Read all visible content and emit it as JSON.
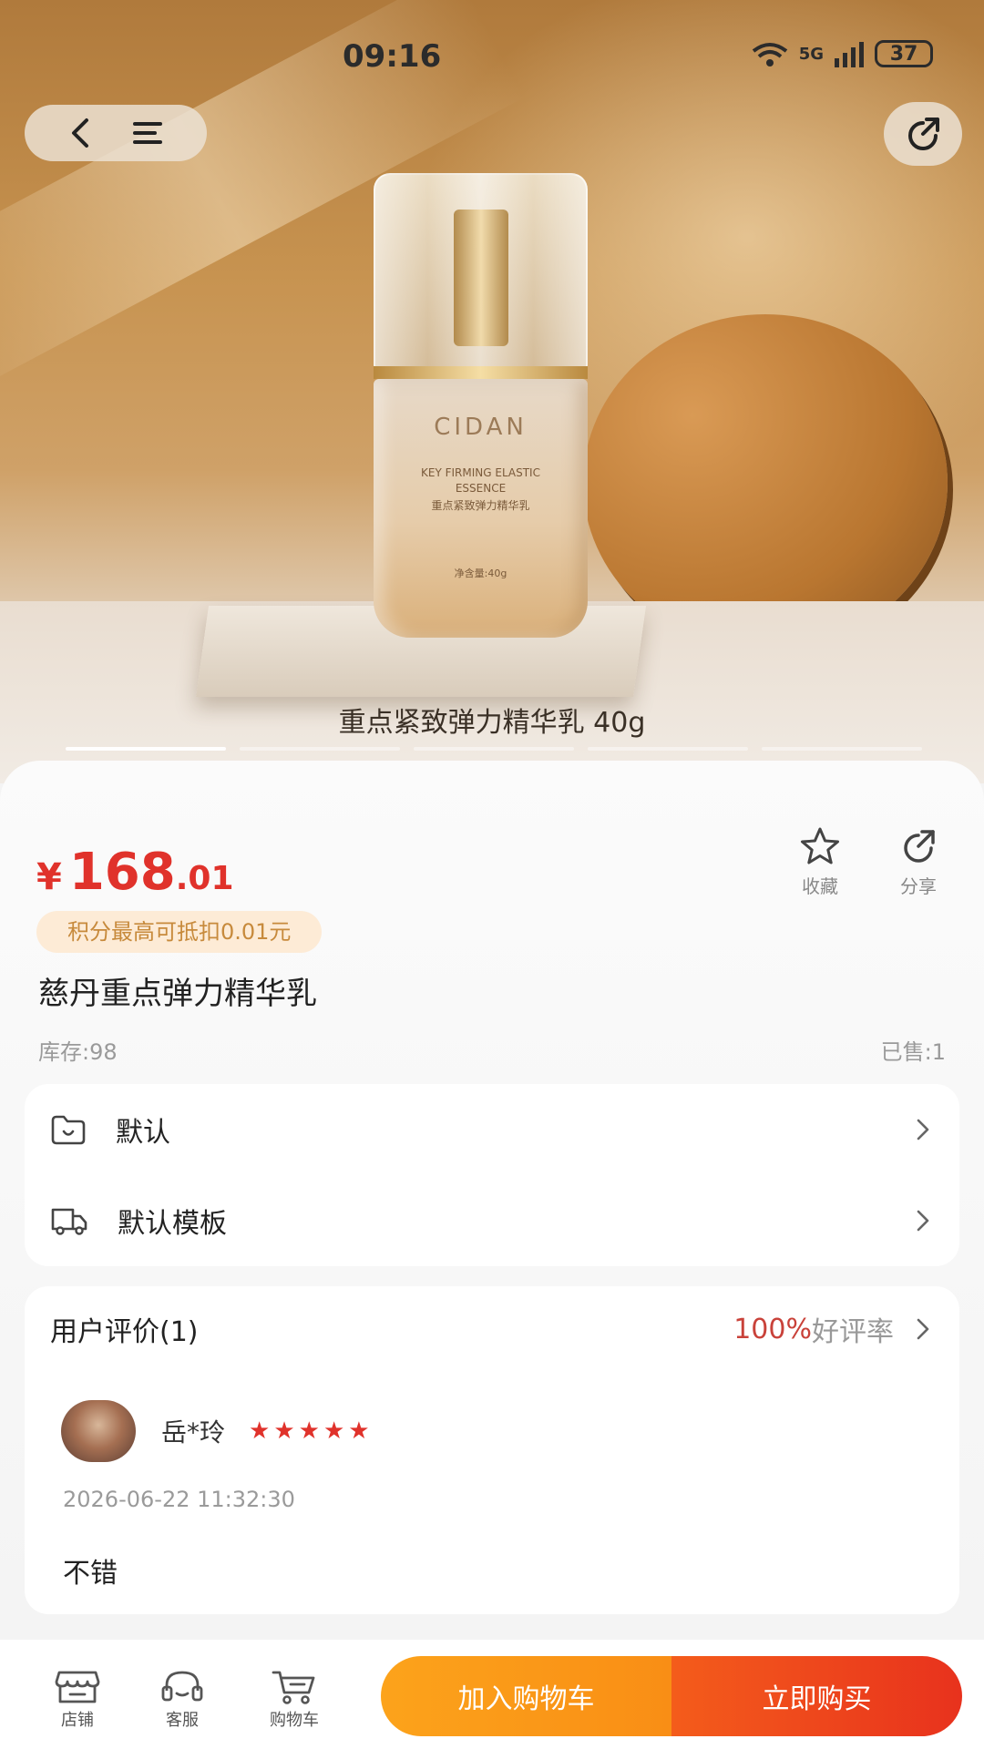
{
  "status_bar": {
    "time": "09:16",
    "network": "5G",
    "battery": "37"
  },
  "hero": {
    "caption": "重点紧致弹力精华乳 40g",
    "bottle_brand": "CIDAN",
    "bottle_line1": "KEY FIRMING ELASTIC",
    "bottle_line2": "ESSENCE",
    "bottle_line3": "重点紧致弹力精华乳",
    "bottle_net": "净含量:40g",
    "slide_count": 5,
    "active_slide": 1
  },
  "product": {
    "currency": "¥",
    "price_int": "168",
    "price_dec": ".01",
    "points_note": "积分最高可抵扣0.01元",
    "title": "慈丹重点弹力精华乳",
    "stock": "库存:98",
    "sold": "已售:1"
  },
  "actions": {
    "favorite": "收藏",
    "share": "分享"
  },
  "options": [
    {
      "label": "默认",
      "icon": "folder-icon"
    },
    {
      "label": "默认模板",
      "icon": "delivery-truck-icon"
    }
  ],
  "reviews": {
    "title": "用户评价(1)",
    "rate_value": "100%",
    "rate_label": "好评率",
    "items": [
      {
        "name": "岳*玲",
        "stars": 5,
        "date": "2026-06-22 11:32:30",
        "text": "不错"
      }
    ]
  },
  "bottom_bar": {
    "store": "店铺",
    "service": "客服",
    "cart": "购物车",
    "add_to_cart": "加入购物车",
    "buy_now": "立即购买"
  },
  "colors": {
    "price_red": "#e0322b",
    "cta_orange": "#fca31b",
    "cta_red": "#e8321d",
    "points_badge_bg": "#fdebd6"
  }
}
